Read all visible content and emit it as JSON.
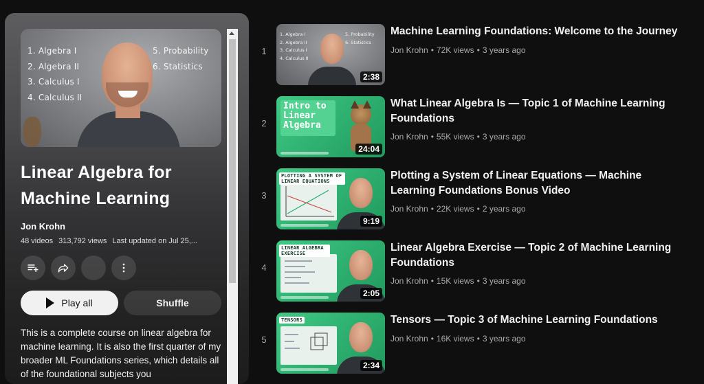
{
  "playlist": {
    "hero_list_left": [
      "1. Algebra I",
      "2. Algebra II",
      "3. Calculus I",
      "4. Calculus II"
    ],
    "hero_list_right": [
      "5. Probability",
      "6. Statistics"
    ],
    "title_line1": "Linear Algebra for",
    "title_line2": "Machine Learning",
    "author": "Jon Krohn",
    "videos_count": "48 videos",
    "views": "313,792 views",
    "updated": "Last updated on Jul 25,...",
    "play_all_label": "Play all",
    "shuffle_label": "Shuffle",
    "description": "This is a complete course on linear algebra for machine learning. It is also the first quarter of my broader ML Foundations series, which details all of the foundational subjects you"
  },
  "icons": {
    "save": "playlist-add-icon",
    "share": "share-icon",
    "blank": "empty-icon",
    "more": "more-vert-icon"
  },
  "videos": [
    {
      "index": "1",
      "title": "Machine Learning Foundations: Welcome to the Journey",
      "channel": "Jon Krohn",
      "views": "72K views",
      "age": "3 years ago",
      "duration": "2:38",
      "mini_list_left": [
        "1. Algebra I",
        "2. Algebra II",
        "3. Calculus I",
        "4. Calculus II"
      ],
      "mini_list_right": [
        "5. Probability",
        "6. Statistics"
      ]
    },
    {
      "index": "2",
      "title": "What Linear Algebra Is — Topic 1 of Machine Learning Foundations",
      "channel": "Jon Krohn",
      "views": "55K views",
      "age": "3 years ago",
      "duration": "24:04",
      "thumb_text": "Intro to Linear Algebra"
    },
    {
      "index": "3",
      "title": "Plotting a System of Linear Equations — Machine Learning Foundations Bonus Video",
      "channel": "Jon Krohn",
      "views": "22K views",
      "age": "2 years ago",
      "duration": "9:19",
      "thumb_label": "PLOTTING A SYSTEM OF LINEAR EQUATIONS"
    },
    {
      "index": "4",
      "title": "Linear Algebra Exercise — Topic 2 of Machine Learning Foundations",
      "channel": "Jon Krohn",
      "views": "15K views",
      "age": "3 years ago",
      "duration": "2:05",
      "thumb_label": "LINEAR ALGEBRA EXERCISE"
    },
    {
      "index": "5",
      "title": "Tensors — Topic 3 of Machine Learning Foundations",
      "channel": "Jon Krohn",
      "views": "16K views",
      "age": "3 years ago",
      "duration": "2:34",
      "thumb_label": "TENSORS"
    }
  ]
}
